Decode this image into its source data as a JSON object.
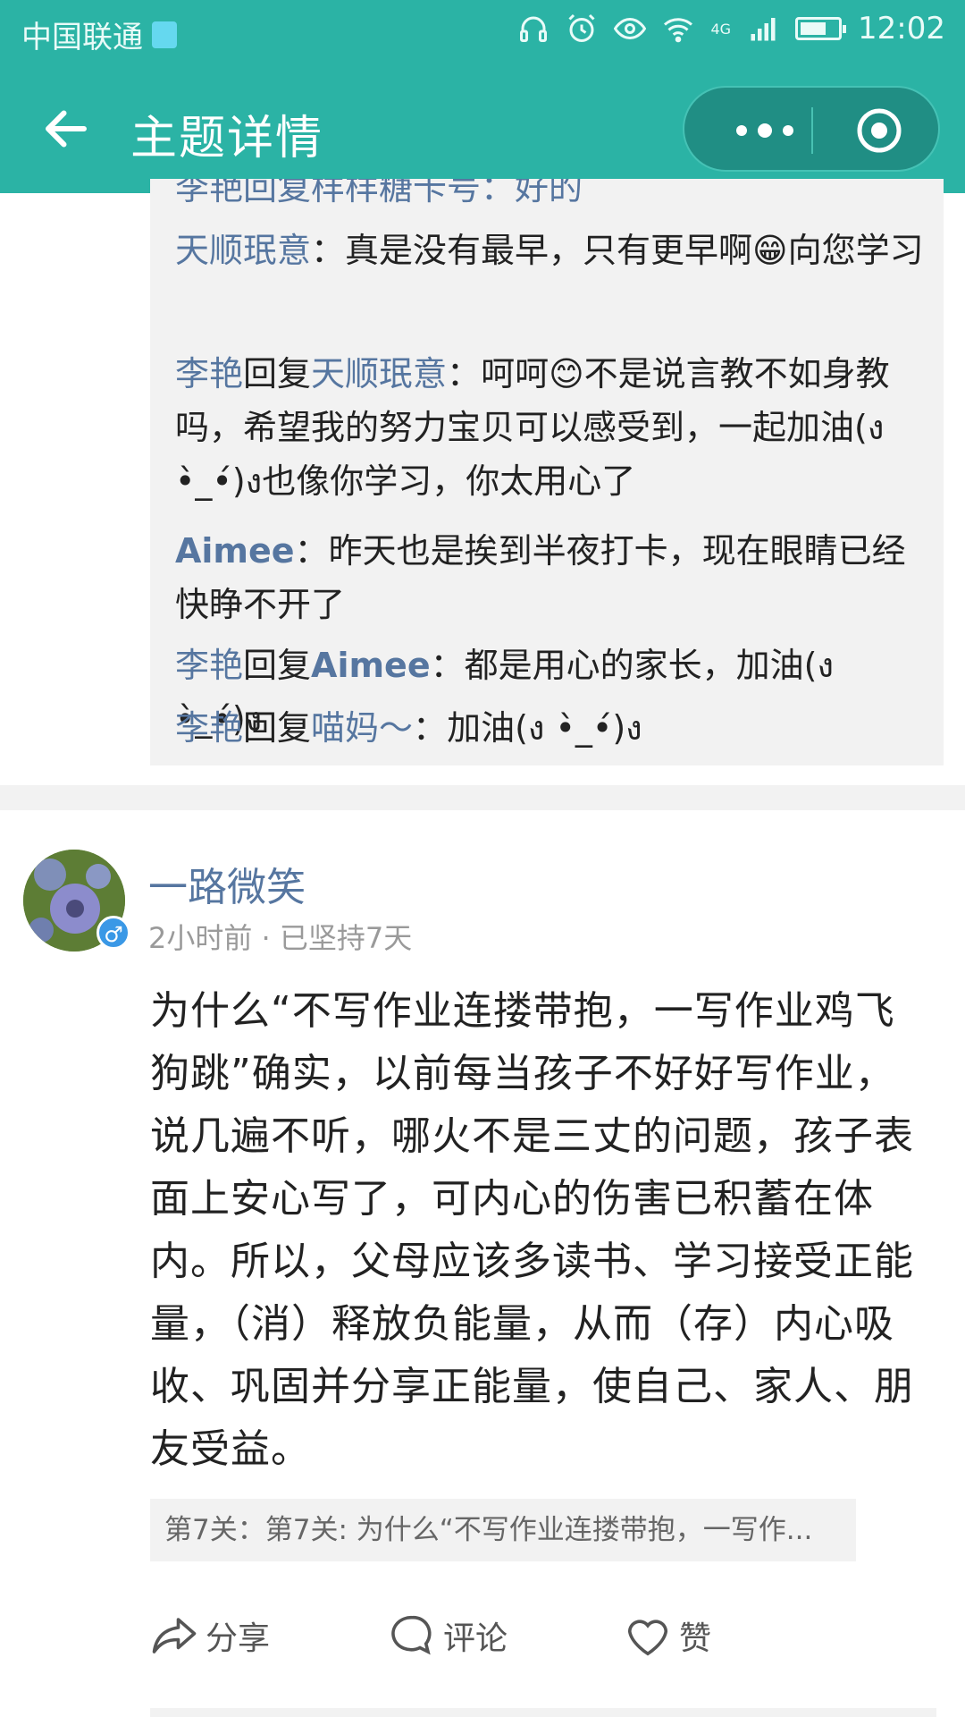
{
  "status_bar": {
    "carrier": "中国联通",
    "network": "4G",
    "time": "12:02",
    "battery_level": 0.7
  },
  "header": {
    "title": "主题详情",
    "back_icon": "arrow-left-icon",
    "more_icon": "more-dots-icon",
    "close_icon": "target-close-icon"
  },
  "comments": {
    "partial_line": "李艳回复样样糖卡号：好的",
    "items": [
      {
        "name": "天顺珉意",
        "reply_to": "",
        "text": "真是没有最早，只有更早啊😁向您学习"
      },
      {
        "name": "李艳",
        "reply_to": "天顺珉意",
        "text": "呵呵😊不是说言教不如身教吗，希望我的努力宝贝可以感受到，一起加油(ง •̀_•́)ง也像你学习，你太用心了"
      },
      {
        "name": "Aimee",
        "reply_to": "",
        "text": "昨天也是挨到半夜打卡，现在眼睛已经快睁不开了"
      },
      {
        "name": "李艳",
        "reply_to": "Aimee",
        "text": "都是用心的家长，加油(ง •̀_•́)ง"
      },
      {
        "name": "李艳",
        "reply_to": "喵妈～",
        "text": "加油(ง •̀_•́)ง"
      }
    ],
    "reply_word": "回复",
    "colon": "："
  },
  "post": {
    "author": "一路微笑",
    "meta": "2小时前 · 已坚持7天",
    "body": "为什么“不写作业连搂带抱，一写作业鸡飞狗跳”确实，以前每当孩子不好好写作业，说几遍不听，哪火不是三丈的问题，孩子表面上安心写了，可内心的伤害已积蓄在体内。所以，父母应该多读书、学习接受正能量，（消）释放负能量，从而（存）内心吸收、巩固并分享正能量，使自己、家人、朋友受益。",
    "tag": "第7关：第7关: 为什么“不写作业连搂带抱，一写作..."
  },
  "actions": {
    "share": "分享",
    "comment": "评论",
    "like": "赞"
  },
  "colors": {
    "header_bg": "#2bb3a5",
    "name_color": "#5676a0"
  }
}
